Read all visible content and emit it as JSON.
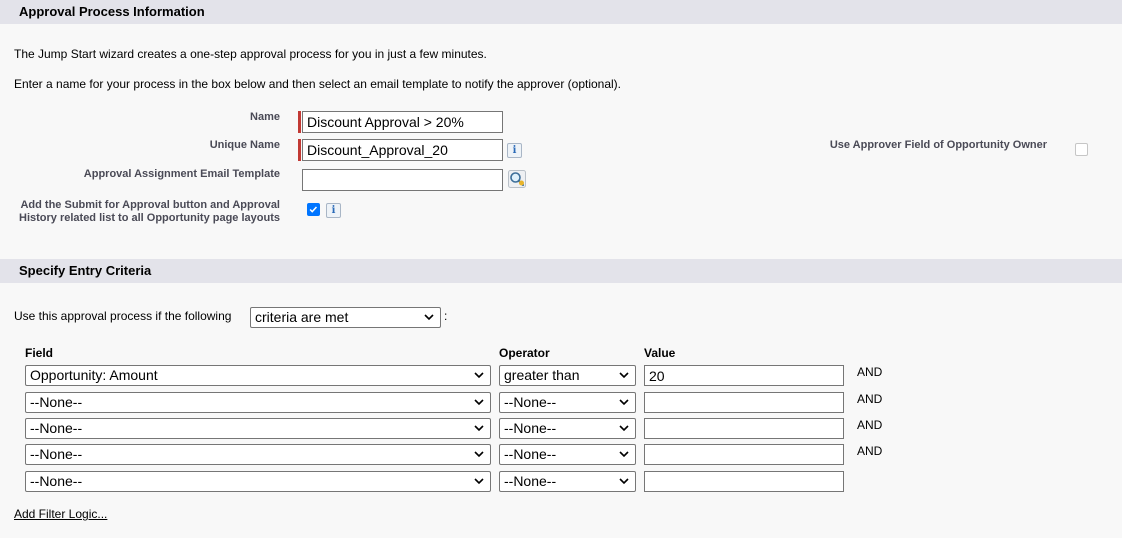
{
  "approval_info": {
    "title": "Approval Process Information",
    "intro_line1": "The Jump Start wizard creates a one-step approval process for you in just a few minutes.",
    "intro_line2": "Enter a name for your process in the box below and then select an email template to notify the approver (optional).",
    "name_label": "Name",
    "name_value": "Discount Approval > 20%",
    "unique_name_label": "Unique Name",
    "unique_name_value": "Discount_Approval_20",
    "email_template_label": "Approval Assignment Email Template",
    "email_template_value": "",
    "submit_button_label": "Add the Submit for Approval button and Approval History related list to all Opportunity page layouts",
    "submit_button_checked": true,
    "approver_field_label": "Use Approver Field of Opportunity Owner",
    "approver_field_checked": false,
    "info_glyph": "i"
  },
  "entry_criteria": {
    "title": "Specify Entry Criteria",
    "use_if_text": "Use this approval process if the following",
    "criteria_mode": "criteria are met",
    "colon": ":",
    "col_field": "Field",
    "col_operator": "Operator",
    "col_value": "Value",
    "rows": [
      {
        "field": "Opportunity: Amount",
        "operator": "greater than",
        "value": "20",
        "conj": "AND"
      },
      {
        "field": "--None--",
        "operator": "--None--",
        "value": "",
        "conj": "AND"
      },
      {
        "field": "--None--",
        "operator": "--None--",
        "value": "",
        "conj": "AND"
      },
      {
        "field": "--None--",
        "operator": "--None--",
        "value": "",
        "conj": "AND"
      },
      {
        "field": "--None--",
        "operator": "--None--",
        "value": "",
        "conj": ""
      }
    ],
    "add_filter_logic": "Add Filter Logic..."
  },
  "icons": {
    "info": "info-icon",
    "lookup": "lookup-magnifier-icon",
    "dropdown": "chevron-down-icon",
    "check": "checkmark-icon"
  },
  "colors": {
    "header_bg": "#e3e3ea",
    "required": "#c23934",
    "checkbox_checked": "#0075ff"
  }
}
